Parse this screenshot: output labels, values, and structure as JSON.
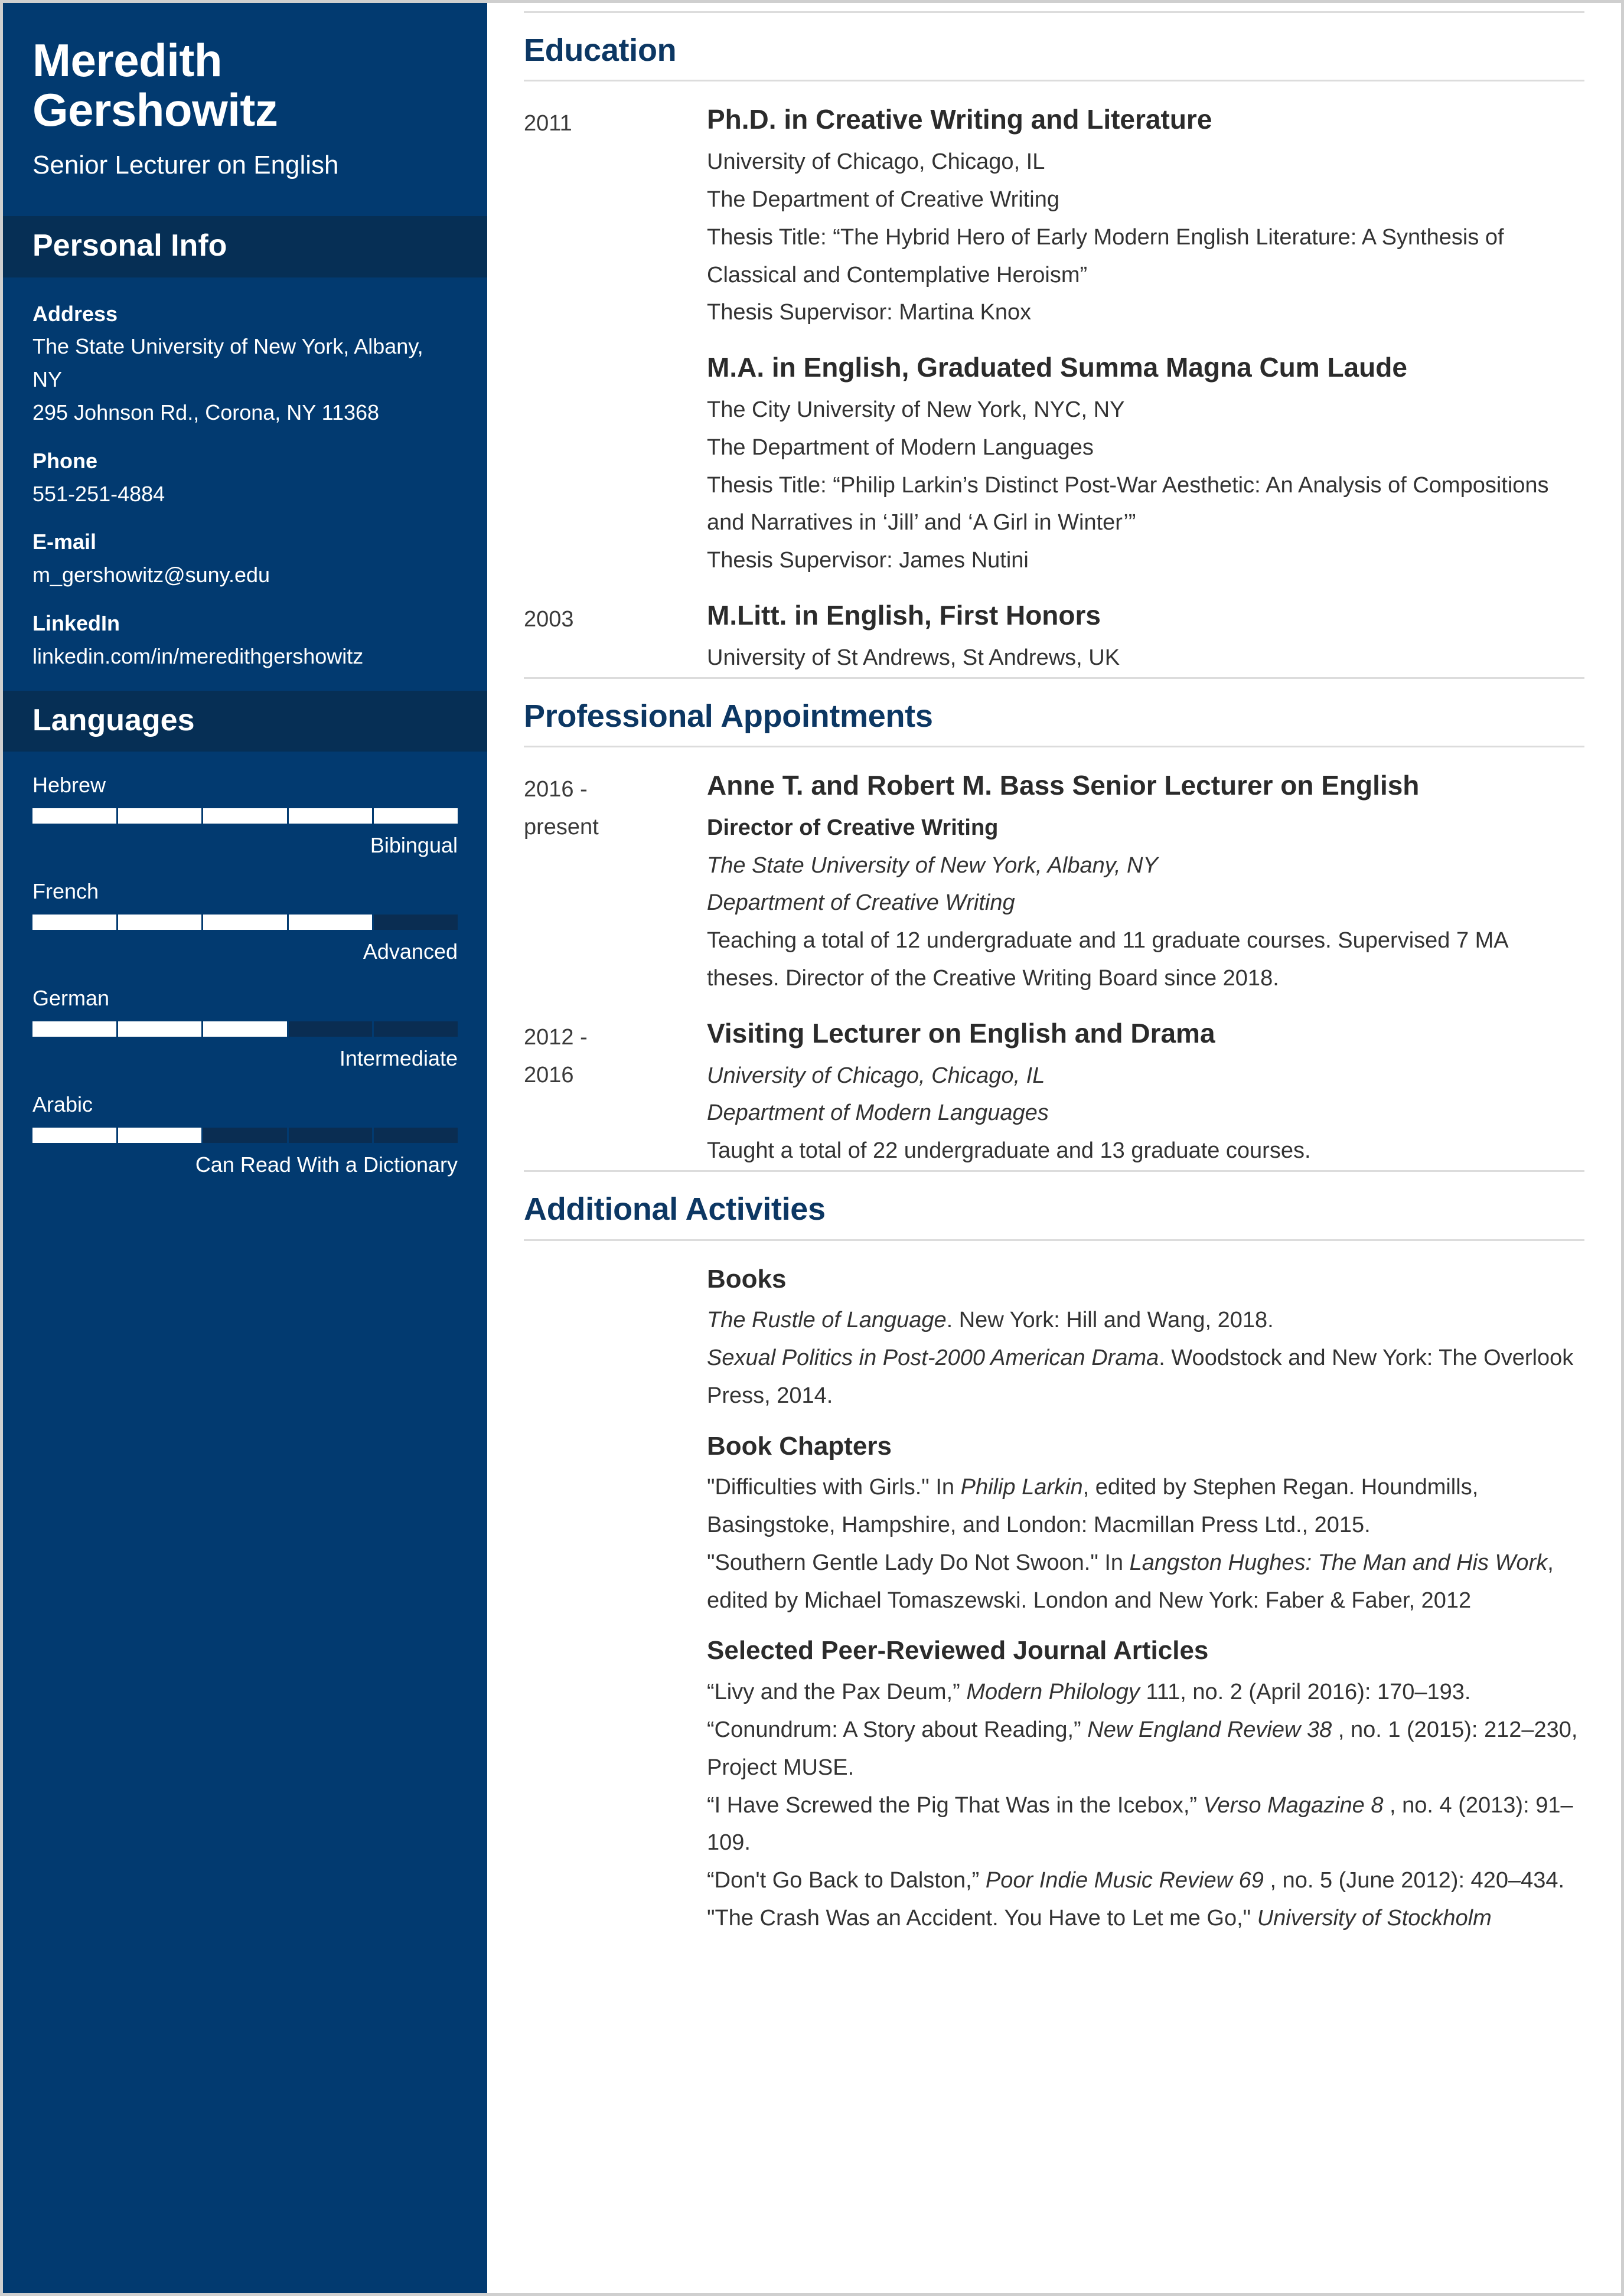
{
  "sidebar": {
    "name": "Meredith Gershowitz",
    "role": "Senior Lecturer on English",
    "personal_info": {
      "heading": "Personal Info",
      "groups": [
        {
          "label": "Address",
          "lines": [
            "The State University of New York, Albany, NY",
            "295 Johnson Rd., Corona, NY 11368"
          ]
        },
        {
          "label": "Phone",
          "lines": [
            "551-251-4884"
          ]
        },
        {
          "label": "E-mail",
          "lines": [
            "m_gershowitz@suny.edu"
          ]
        },
        {
          "label": "LinkedIn",
          "lines": [
            "linkedin.com/in/meredithgershowitz"
          ]
        }
      ]
    },
    "languages": {
      "heading": "Languages",
      "items": [
        {
          "name": "Hebrew",
          "level_label": "Bibingual",
          "filled": 5,
          "total": 5
        },
        {
          "name": "French",
          "level_label": "Advanced",
          "filled": 4,
          "total": 5
        },
        {
          "name": "German",
          "level_label": "Intermediate",
          "filled": 3,
          "total": 5
        },
        {
          "name": "Arabic",
          "level_label": "Can Read With a Dictionary",
          "filled": 2,
          "total": 5
        }
      ]
    }
  },
  "main": {
    "education": {
      "heading": "Education",
      "entries": [
        {
          "date": [
            "2011"
          ],
          "title": "Ph.D. in Creative Writing and Literature",
          "lines": [
            "University of Chicago, Chicago, IL",
            "The Department of Creative Writing",
            "Thesis Title: “The Hybrid Hero of Early Modern English Literature: A Synthesis of Classical and Contemplative Heroism”",
            "Thesis Supervisor: Martina Knox"
          ]
        },
        {
          "date": [],
          "title": "M.A. in English, Graduated Summa Magna Cum Laude",
          "lines": [
            "The City University of New York, NYC, NY",
            "The Department of Modern Languages",
            "Thesis Title: “Philip Larkin’s Distinct Post-War Aesthetic: An Analysis of Compositions and Narratives in ‘Jill’ and ‘A Girl in Winter’”",
            "Thesis Supervisor: James Nutini"
          ]
        },
        {
          "date": [
            "2003"
          ],
          "title": "M.Litt. in English, First Honors",
          "lines": [
            "University of St Andrews, St Andrews, UK"
          ]
        }
      ]
    },
    "appointments": {
      "heading": "Professional Appointments",
      "entries": [
        {
          "date": [
            "2016 -",
            "present"
          ],
          "title": "Anne T. and Robert M. Bass Senior Lecturer on English",
          "subtitle_bold": "Director of Creative Writing",
          "italic_lines": [
            "The State University of New York, Albany, NY",
            "Department of Creative Writing"
          ],
          "lines": [
            "Teaching a total of 12 undergraduate and 11 graduate courses. Supervised 7 MA theses. Director of the Creative Writing Board since 2018."
          ]
        },
        {
          "date": [
            "2012 -",
            "2016"
          ],
          "title": "Visiting Lecturer on English and Drama",
          "subtitle_bold": "",
          "italic_lines": [
            "University of Chicago, Chicago, IL",
            "Department of Modern Languages"
          ],
          "lines": [
            "Taught a total of 22 undergraduate and 13 graduate courses."
          ]
        }
      ]
    },
    "activities": {
      "heading": "Additional Activities",
      "blocks": [
        {
          "title": "Books",
          "items_html": [
            "<i>The Rustle of Language</i>. New York: Hill and Wang, 2018.",
            "<i>Sexual Politics in Post-2000 American Drama</i>. Woodstock and New York: The Overlook Press, 2014."
          ]
        },
        {
          "title": "Book Chapters",
          "items_html": [
            "\"Difficulties with Girls.\" In <i>Philip Larkin</i>, edited by Stephen Regan. Houndmills, Basingstoke, Hampshire, and London: Macmillan Press Ltd., 2015.",
            "\"Southern Gentle Lady Do Not Swoon.\" In <i>Langston Hughes: The Man and His Work</i>, edited by Michael Tomaszewski. London and New York: Faber &amp; Faber, 2012"
          ]
        },
        {
          "title": "Selected Peer-Reviewed Journal Articles",
          "items_html": [
            "“Livy and the Pax Deum,” <i>Modern Philology</i> 111, no. 2 (April 2016): 170–193.",
            "“Conundrum: A Story about Reading,” <i>New England Review 38</i> , no. 1 (2015): 212–230, Project MUSE.",
            "“I Have Screwed the Pig That Was in the Icebox,” <i>Verso Magazine 8</i> , no. 4 (2013): 91–109.",
            "“Don't Go Back to Dalston,” <i>Poor Indie Music Review 69</i> , no. 5 (June 2012): 420–434.",
            "\"The Crash Was an Accident. You Have to Let me Go,\" <i>University of Stockholm</i>"
          ]
        }
      ]
    }
  },
  "colors": {
    "sidebar_bg": "#023A70",
    "sidebar_band": "#062F55",
    "bar_empty": "#0A2D52",
    "bar_fill": "#FFFFFF",
    "heading_blue": "#0C3763",
    "rule": "#DCDCDC"
  }
}
